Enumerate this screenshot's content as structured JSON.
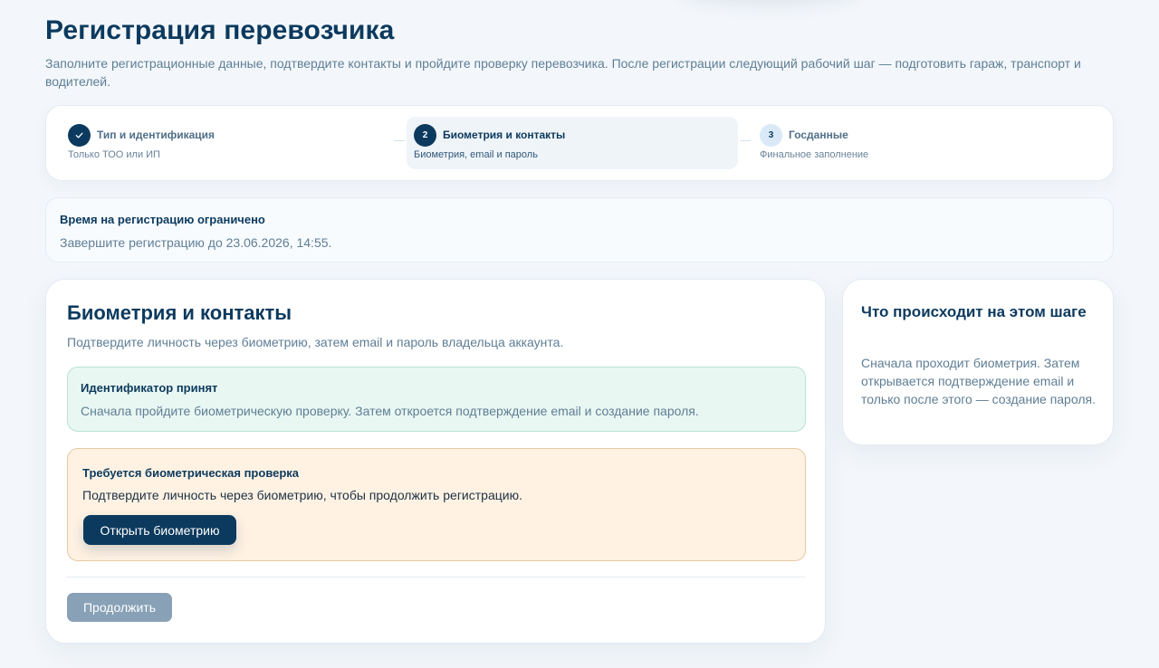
{
  "header": {
    "title": "Регистрация перевозчика",
    "subtitle": "Заполните регистрационные данные, подтвердите контакты и пройдите проверку перевозчика. После регистрации следующий рабочий шаг — подготовить гараж, транспорт и водителей."
  },
  "stepper": {
    "steps": [
      {
        "number": "",
        "title": "Тип и идентификация",
        "subtitle": "Только ТОО или ИП",
        "status": "done"
      },
      {
        "number": "2",
        "title": "Биометрия и контакты",
        "subtitle": "Биометрия, email и пароль",
        "status": "active"
      },
      {
        "number": "3",
        "title": "Госданные",
        "subtitle": "Финальное заполнение",
        "status": "todo"
      }
    ]
  },
  "timer": {
    "title": "Время на регистрацию ограничено",
    "text": "Завершите регистрацию до 23.06.2026, 14:55."
  },
  "main": {
    "title": "Биометрия и контакты",
    "subtitle": "Подтвердите личность через биометрию, затем email и пароль владельца аккаунта.",
    "success_alert": {
      "title": "Идентификатор принят",
      "text": "Сначала пройдите биометрическую проверку. Затем откроется подтверждение email и создание пароля."
    },
    "warning_alert": {
      "title": "Требуется биометрическая проверка",
      "text": "Подтвердите личность через биометрию, чтобы продолжить регистрацию.",
      "button_label": "Открыть биометрию"
    },
    "continue_label": "Продолжить"
  },
  "side": {
    "title": "Что происходит на этом шаге",
    "text": "Сначала проходит биометрия. Затем открывается подтверждение email и только после этого — создание пароля."
  },
  "colors": {
    "primary": "#0c3a5e",
    "success_bg": "#e9f7f2",
    "warning_bg": "#fff2e3",
    "disabled": "#88a1b6"
  },
  "icons": {
    "step_done": "check-icon"
  }
}
